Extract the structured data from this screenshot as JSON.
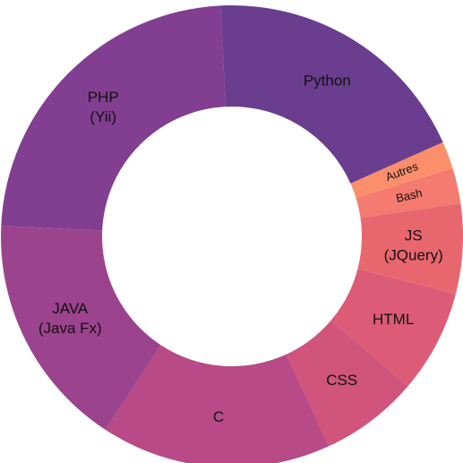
{
  "chart_data": {
    "type": "pie",
    "donut": true,
    "start_angle_deg": -2.8,
    "direction": "clockwise",
    "slices": [
      {
        "label": [
          "Python"
        ],
        "value": 19.1,
        "color": "#6a3d8f"
      },
      {
        "label": [
          "Autres"
        ],
        "value": 1.9,
        "color": "#fc8f6b",
        "small": true,
        "rotate": true
      },
      {
        "label": [
          "Bash"
        ],
        "value": 2.5,
        "color": "#f57a6f",
        "small": true,
        "rotate": true
      },
      {
        "label": [
          "JS",
          "(JQuery)"
        ],
        "value": 6.3,
        "color": "#e8676f"
      },
      {
        "label": [
          "HTML"
        ],
        "value": 7.2,
        "color": "#dc5b76"
      },
      {
        "label": [
          "CSS"
        ],
        "value": 6.9,
        "color": "#d0547c"
      },
      {
        "label": [
          "C"
        ],
        "value": 16.1,
        "color": "#b84a87"
      },
      {
        "label": [
          "JAVA",
          "(Java Fx)"
        ],
        "value": 16.5,
        "color": "#9c438e"
      },
      {
        "label": [
          "PHP",
          "(Yii)"
        ],
        "value": 23.5,
        "color": "#823e90"
      }
    ]
  }
}
